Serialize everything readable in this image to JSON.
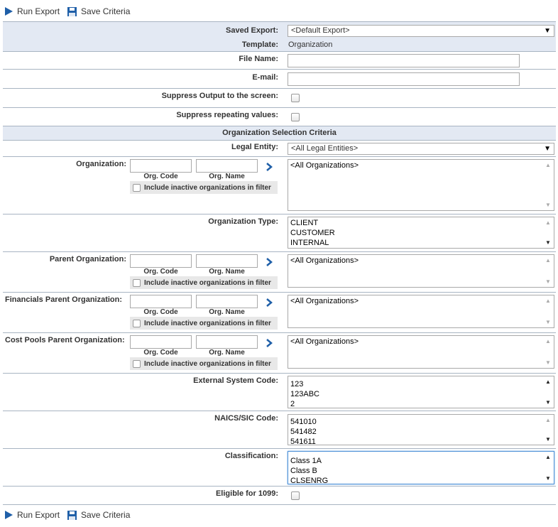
{
  "toolbar": {
    "run_export": "Run Export",
    "save_criteria": "Save Criteria"
  },
  "form": {
    "saved_export": {
      "label": "Saved Export:",
      "value": "<Default Export>"
    },
    "template": {
      "label": "Template:",
      "value": "Organization"
    },
    "file_name": {
      "label": "File Name:",
      "value": ""
    },
    "email": {
      "label": "E-mail:",
      "value": ""
    },
    "suppress_output": {
      "label": "Suppress Output to the screen:",
      "checked": false
    },
    "suppress_repeating": {
      "label": "Suppress repeating values:",
      "checked": false
    }
  },
  "section_title": "Organization Selection Criteria",
  "legal_entity": {
    "label": "Legal Entity:",
    "value": "<All Legal Entities>"
  },
  "org_filter": {
    "org_code_label": "Org. Code",
    "org_name_label": "Org. Name",
    "inactive_label": "Include inactive organizations in filter",
    "all_orgs": "<All Organizations>"
  },
  "organization": {
    "label": "Organization:"
  },
  "organization_type": {
    "label": "Organization Type:",
    "options": [
      "CLIENT",
      "CUSTOMER",
      "INTERNAL"
    ]
  },
  "parent_organization": {
    "label": "Parent Organization:"
  },
  "financials_parent": {
    "label": "Financials Parent Organization:"
  },
  "cost_pools_parent": {
    "label": "Cost Pools Parent Organization:"
  },
  "external_system_code": {
    "label": "External System Code:",
    "options": [
      "123",
      "123ABC",
      "2"
    ]
  },
  "naics_sic": {
    "label": "NAICS/SIC Code:",
    "options": [
      "541010",
      "541482",
      "541611"
    ]
  },
  "classification": {
    "label": "Classification:",
    "options": [
      "Class 1A",
      "Class B",
      "CLSENRG"
    ]
  },
  "eligible_1099": {
    "label": "Eligible for 1099:",
    "checked": false
  },
  "colors": {
    "row_shade": "#e3e9f3",
    "border": "#a8b4c2",
    "accent": "#1f5fa8"
  }
}
